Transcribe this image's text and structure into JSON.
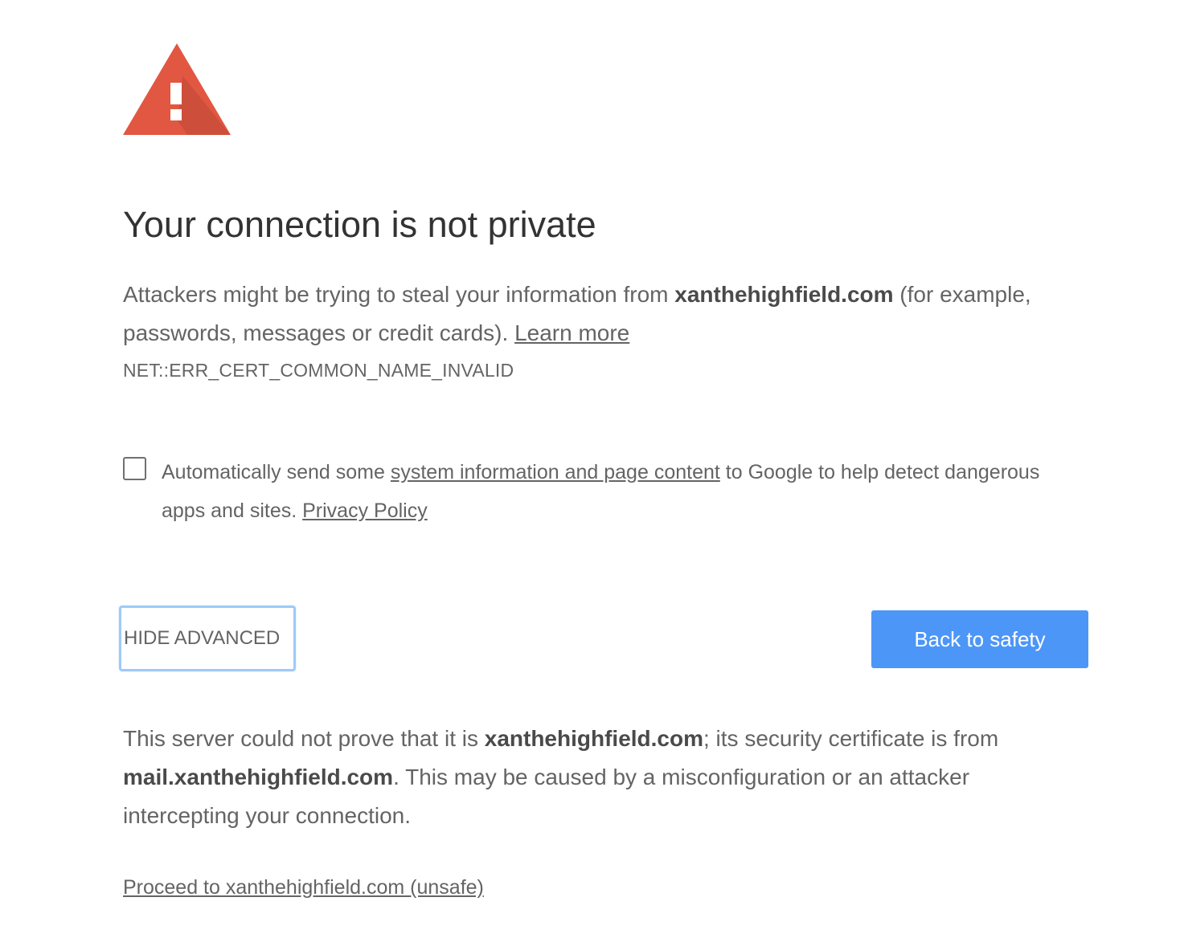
{
  "title": "Your connection is not private",
  "intro": {
    "before": "Attackers might be trying to steal your information from ",
    "domain": "xanthehighfield.com",
    "after": " (for example, passwords, messages or credit cards). ",
    "learn_more": "Learn more"
  },
  "error_code": "NET::ERR_CERT_COMMON_NAME_INVALID",
  "optin": {
    "checked": false,
    "before": "Automatically send some ",
    "link": "system information and page content",
    "middle": " to Google to help detect dangerous apps and sites. ",
    "privacy_link": "Privacy Policy"
  },
  "buttons": {
    "hide_advanced": "HIDE ADVANCED",
    "back_to_safety": "Back to safety"
  },
  "explanation": {
    "part1": "This server could not prove that it is ",
    "domain": "xanthehighfield.com",
    "part2": "; its security certificate is from ",
    "cert_domain": "mail.xanthehighfield.com",
    "part3": ". This may be caused by a misconfiguration or an attacker intercepting your connection."
  },
  "proceed_link": "Proceed to xanthehighfield.com (unsafe)",
  "colors": {
    "warning_red": "#e25741",
    "primary_blue": "#4c96f8",
    "focus_ring": "#9ecaf8"
  },
  "icons": {
    "warning": "warning-triangle-icon"
  }
}
